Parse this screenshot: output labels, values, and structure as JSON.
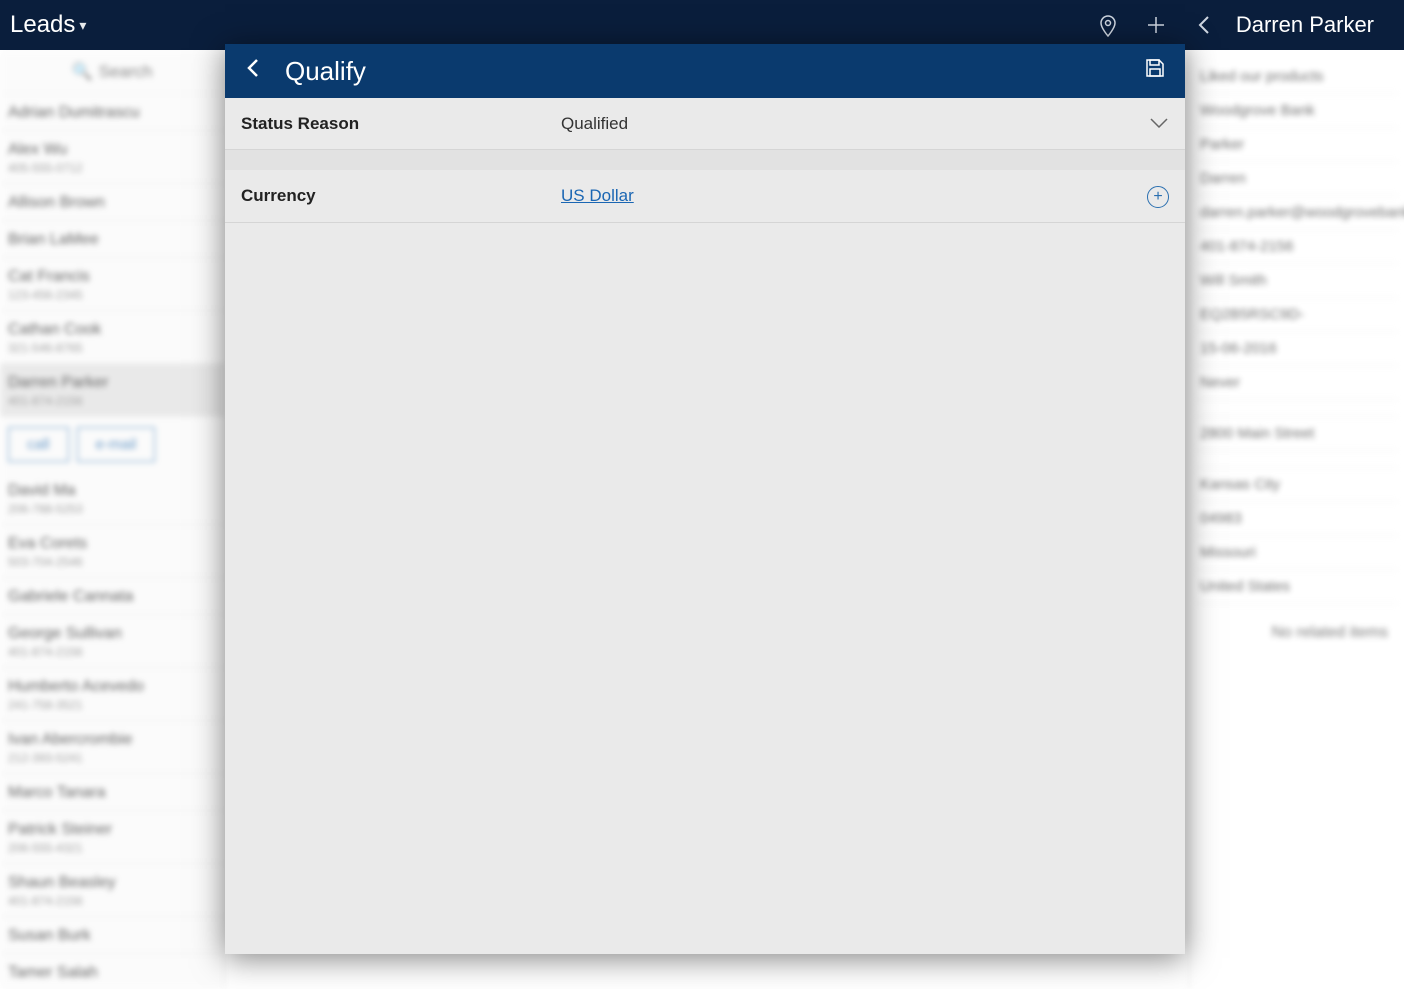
{
  "header": {
    "title": "Leads",
    "lead_name": "Darren Parker"
  },
  "search": {
    "placeholder": "Search"
  },
  "leads": [
    {
      "name": "Adrian Dumitrascu",
      "sub": ""
    },
    {
      "name": "Alex Wu",
      "sub": "405-555-0712"
    },
    {
      "name": "Allison Brown",
      "sub": ""
    },
    {
      "name": "Brian LaMee",
      "sub": ""
    },
    {
      "name": "Cat Francis",
      "sub": "123-456-2345"
    },
    {
      "name": "Cathan Cook",
      "sub": "321-546-8765"
    },
    {
      "name": "Darren Parker",
      "sub": "401-874-2156",
      "selected": true
    },
    {
      "name": "David Ma",
      "sub": "206-788-5253"
    },
    {
      "name": "Eva Corets",
      "sub": "503-704-2546"
    },
    {
      "name": "Gabriele Cannata",
      "sub": ""
    },
    {
      "name": "George Sullivan",
      "sub": "401-874-2156"
    },
    {
      "name": "Humberto Acevedo",
      "sub": "241-758-3521"
    },
    {
      "name": "Ivan Abercrombie",
      "sub": "212-393-5241"
    },
    {
      "name": "Marco Tanara",
      "sub": ""
    },
    {
      "name": "Patrick Steiner",
      "sub": "206-555-4321"
    },
    {
      "name": "Shaun Beasley",
      "sub": "401-874-2156"
    },
    {
      "name": "Susan Burk",
      "sub": ""
    },
    {
      "name": "Tamer Salah",
      "sub": ""
    }
  ],
  "actions": {
    "call": "call",
    "email": "e-mail"
  },
  "right": {
    "rows": [
      "Liked our products",
      "Woodgrove Bank",
      "Parker",
      "Darren",
      "darren.parker@woodgrovebank",
      "401-874-2156",
      "Will Smith",
      "EQ2B5RSC9D-",
      "15-06-2016",
      "Never",
      "",
      "2800 Main Street",
      "",
      "Kansas City",
      "04983",
      "Missouri",
      "United States"
    ],
    "no_related": "No related items"
  },
  "modal": {
    "title": "Qualify",
    "fields": {
      "status_reason": {
        "label": "Status Reason",
        "value": "Qualified"
      },
      "currency": {
        "label": "Currency",
        "value": "US Dollar"
      }
    }
  }
}
